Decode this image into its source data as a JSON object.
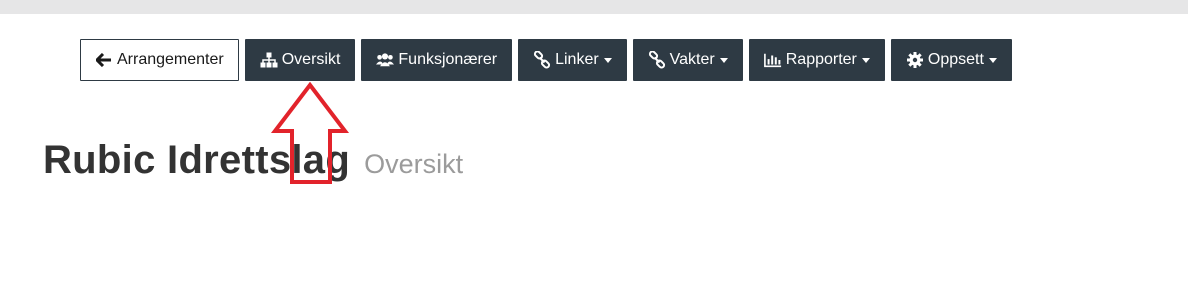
{
  "nav": {
    "back_label": "Arrangementer",
    "oversikt_label": "Oversikt",
    "funksjonaerer_label": "Funksjonærer",
    "linker_label": "Linker",
    "vakter_label": "Vakter",
    "rapporter_label": "Rapporter",
    "oppsett_label": "Oppsett"
  },
  "page": {
    "title": "Rubic Idrettslag",
    "subtitle": "Oversikt"
  },
  "icons": {
    "back": "arrow-left-icon",
    "oversikt": "sitemap-icon",
    "funksjonaerer": "users-icon",
    "linker": "link-icon",
    "vakter": "link-icon",
    "rapporter": "bar-chart-icon",
    "oppsett": "gear-icon"
  },
  "colors": {
    "button_bg": "#2e3a44",
    "annotation_arrow": "#e2232b",
    "title": "#333333",
    "subtitle": "#9b9b9b"
  }
}
